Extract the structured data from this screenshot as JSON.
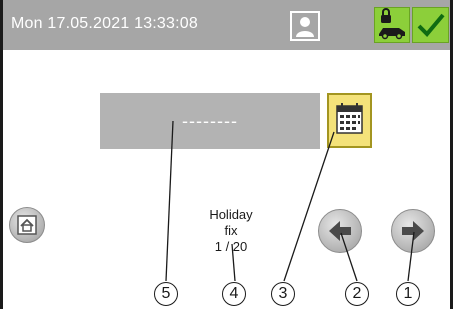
{
  "status_bar": {
    "datetime": "Mon 17.05.2021  13:33:08"
  },
  "icons": {
    "user": "user-icon",
    "car_lock": "car-lock-icon",
    "ok": "checkmark-icon",
    "calendar": "calendar-icon",
    "home": "home-icon",
    "prev": "arrow-left-icon",
    "next": "arrow-right-icon"
  },
  "main": {
    "value_field": "--------",
    "holiday_line1": "Holiday",
    "holiday_line2": "fix",
    "holiday_line3": "1 / 20"
  },
  "callouts": [
    "5",
    "4",
    "3",
    "2",
    "1"
  ],
  "colors": {
    "topbar": "#a6a6a6",
    "accent_green": "#8ccf3a",
    "calendar_yellow": "#f4e27a",
    "field_gray": "#b3b3b3"
  }
}
